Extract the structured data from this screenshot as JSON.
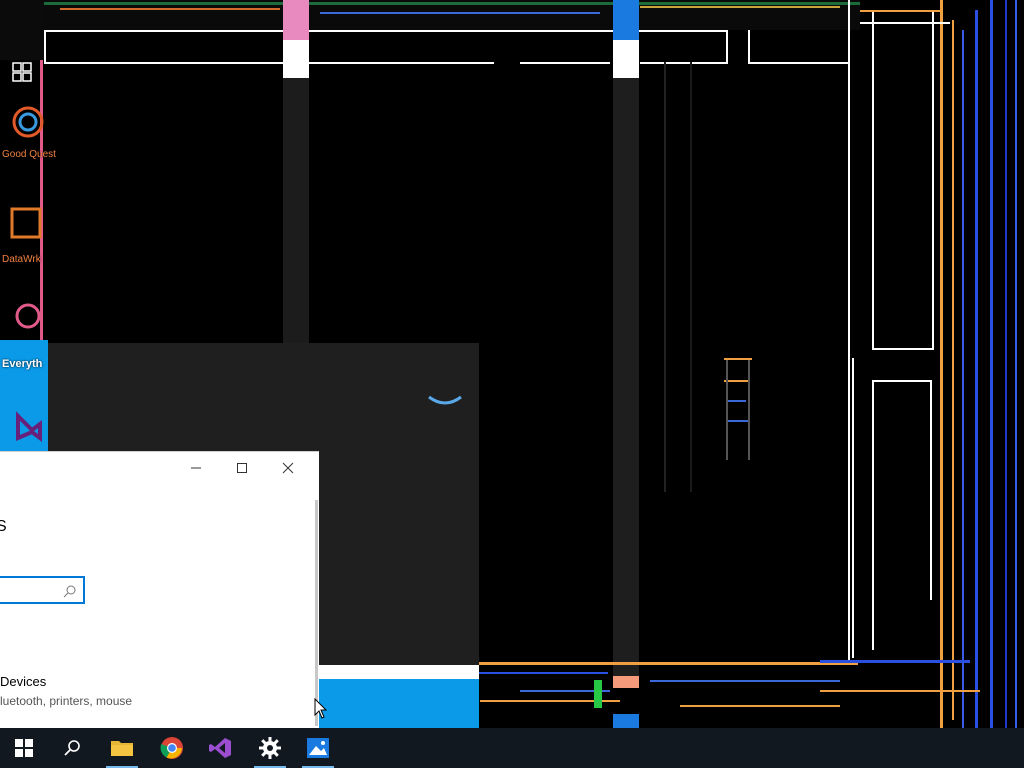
{
  "desktop": {
    "icons": [
      {
        "name": "Good Quest",
        "label": "Good Quest"
      },
      {
        "name": "DataWrk",
        "label": "DataWrk"
      },
      {
        "name": "Everything",
        "label": "Everyth"
      },
      {
        "name": "Visual Studio",
        "label": ""
      }
    ]
  },
  "settings_window": {
    "title_partial": "S",
    "search": {
      "value": "",
      "placeholder": ""
    },
    "devices": {
      "title": "Devices",
      "subtitle": "luetooth, printers, mouse"
    },
    "caption": {
      "minimize": "—",
      "maximize": "☐",
      "close": "✕"
    }
  },
  "taskbar": {
    "items": [
      {
        "name": "start",
        "icon": "windows-logo-icon",
        "active": false
      },
      {
        "name": "search",
        "icon": "search-icon",
        "active": false
      },
      {
        "name": "file-explorer",
        "icon": "folder-icon",
        "active": true
      },
      {
        "name": "chrome",
        "icon": "chrome-icon",
        "active": false
      },
      {
        "name": "visual-studio",
        "icon": "visual-studio-icon",
        "active": false
      },
      {
        "name": "settings",
        "icon": "gear-icon",
        "active": true
      },
      {
        "name": "photos",
        "icon": "photos-icon",
        "active": true
      }
    ]
  }
}
